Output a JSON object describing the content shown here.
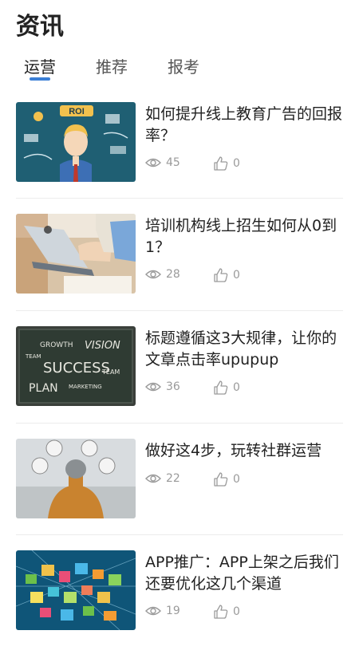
{
  "header": {
    "title": "资讯"
  },
  "tabs": [
    {
      "label": "运营",
      "active": true
    },
    {
      "label": "推荐",
      "active": false
    },
    {
      "label": "报考",
      "active": false
    }
  ],
  "articles": [
    {
      "title": "如何提升线上教育广告的回报率？",
      "views": "45",
      "likes": "0",
      "thumb_text": "ROI"
    },
    {
      "title": "培训机构线上招生如何从0到1？",
      "views": "28",
      "likes": "0"
    },
    {
      "title": "标题遵循这3大规律，让你的文章点击率upupup",
      "views": "36",
      "likes": "0",
      "thumb_words": [
        "GROWTH",
        "VISION",
        "TEAM",
        "SUCCESS",
        "TEAM",
        "PLAN",
        "MARKETING"
      ]
    },
    {
      "title": "做好这4步，玩转社群运营",
      "views": "22",
      "likes": "0"
    },
    {
      "title": "APP推广：APP上架之后我们还要优化这几个渠道",
      "views": "19",
      "likes": "0"
    }
  ],
  "colors": {
    "accent": "#3b7fd6",
    "meta": "#9a9a9a",
    "divider": "#ececec"
  },
  "icons": {
    "views": "eye-icon",
    "likes": "thumbs-up-icon"
  }
}
